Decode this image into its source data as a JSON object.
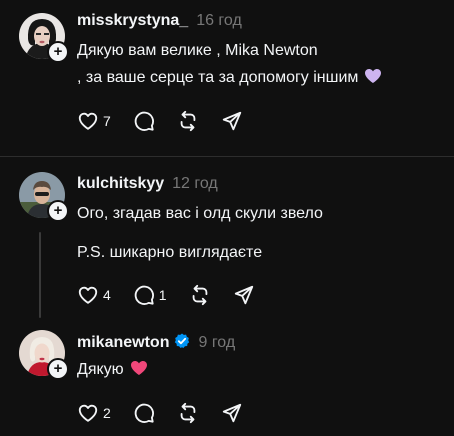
{
  "comments": [
    {
      "username": "misskrystyna_",
      "time": "16 год",
      "lines": [
        "Дякую вам велике , Mika Newton",
        ", за ваше серце та за допомогу іншим"
      ],
      "emoji": "purple-heart",
      "likes": "7",
      "replies": ""
    },
    {
      "username": "kulchitskyy",
      "time": "12 год",
      "lines": [
        "Ого, згадав вас і олд скули звело",
        "P.S. шикарно виглядаєте"
      ],
      "likes": "4",
      "replies": "1"
    },
    {
      "username": "mikanewton",
      "time": "9 год",
      "verified": true,
      "lines": [
        "Дякую"
      ],
      "emoji": "pink-heart",
      "likes": "2",
      "replies": ""
    }
  ],
  "icons": {
    "like": "heart-outline-icon",
    "reply": "speech-bubble-icon",
    "repost": "repost-arrows-icon",
    "share": "paper-plane-icon",
    "follow": "plus-icon"
  },
  "colors": {
    "background": "#101010",
    "text": "#f3f5f7",
    "muted": "#777777",
    "verified": "#0095f6",
    "purple_heart": "#cdb4f0",
    "pink_heart": "#f0477a"
  }
}
